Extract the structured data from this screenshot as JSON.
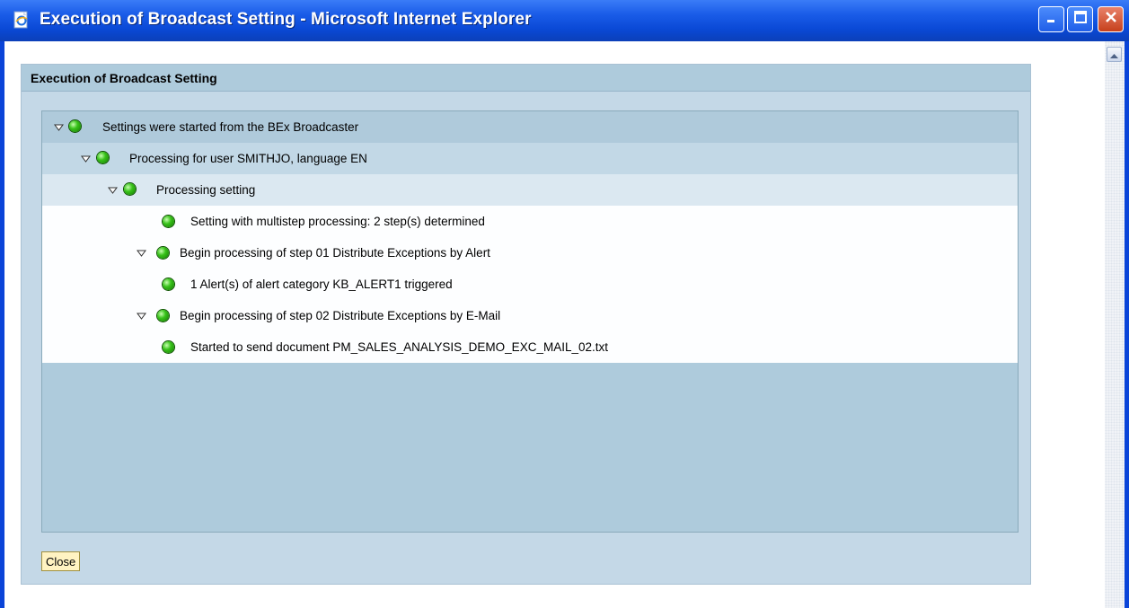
{
  "window": {
    "title": "Execution of Broadcast Setting - Microsoft Internet Explorer",
    "titlebar_color": "#0a49d6"
  },
  "panel": {
    "title": "Execution of Broadcast Setting"
  },
  "tree": {
    "status_color": "#38c21a",
    "nodes": [
      {
        "label": "Settings were started from the BEx Broadcaster",
        "level": 0,
        "expanded": true,
        "status": "green"
      },
      {
        "label": "Processing for user SMITHJO, language EN",
        "level": 1,
        "expanded": true,
        "status": "green"
      },
      {
        "label": "Processing setting",
        "level": 2,
        "expanded": true,
        "status": "green"
      },
      {
        "label": "Setting with multistep processing: 2 step(s) determined",
        "level": 3,
        "status": "green"
      },
      {
        "label": "Begin processing of step 01 Distribute Exceptions by Alert",
        "level": 3,
        "expanded": true,
        "status": "green"
      },
      {
        "label": "1 Alert(s) of alert category KB_ALERT1 triggered",
        "level": 4,
        "status": "green"
      },
      {
        "label": "Begin processing of step 02 Distribute Exceptions by E-Mail",
        "level": 3,
        "expanded": true,
        "status": "green"
      },
      {
        "label": "Started to send document PM_SALES_ANALYSIS_DEMO_EXC_MAIL_02.txt",
        "level": 4,
        "status": "green"
      }
    ]
  },
  "buttons": {
    "close_label": "Close"
  }
}
